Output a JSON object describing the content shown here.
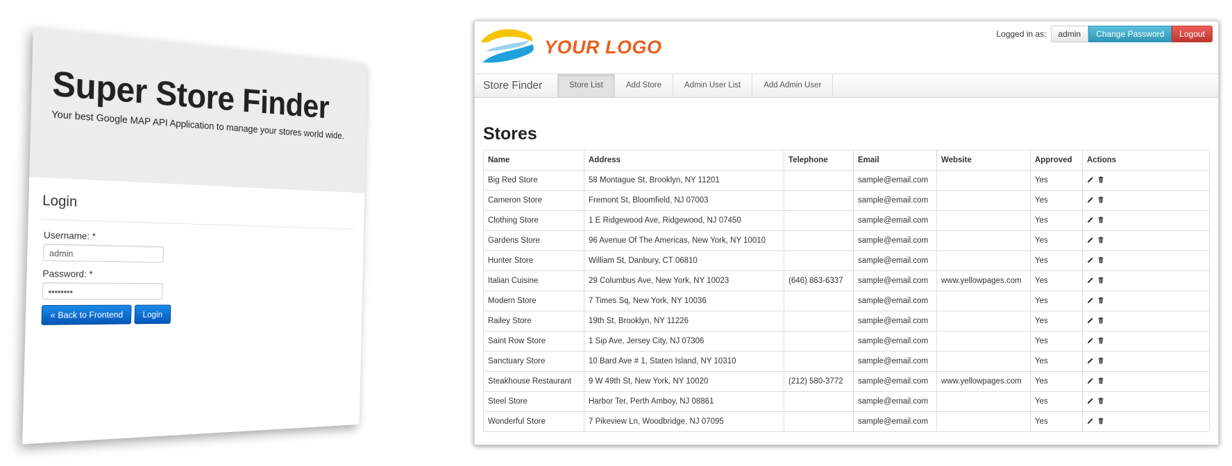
{
  "login_panel": {
    "title": "Super Store Finder",
    "subtitle": "Your best Google MAP API Application to manage your stores world wide.",
    "section_title": "Login",
    "username_label": "Username: *",
    "username_value": "admin",
    "password_label": "Password: *",
    "password_value": "••••••••",
    "back_button": "« Back to Frontend",
    "login_button": "Login"
  },
  "admin": {
    "logo_text": "YOUR LOGO",
    "logged_in_label": "Logged in as:",
    "user_button": "admin",
    "change_password_button": "Change Password",
    "logout_button": "Logout",
    "brand": "Store Finder",
    "nav": [
      "Store List",
      "Add Store",
      "Admin User List",
      "Add Admin User"
    ],
    "active_nav": "Store List",
    "page_title": "Stores",
    "columns": [
      "Name",
      "Address",
      "Telephone",
      "Email",
      "Website",
      "Approved",
      "Actions"
    ],
    "rows": [
      {
        "name": "Big Red Store",
        "address": "58 Montague St, Brooklyn, NY 11201",
        "telephone": "",
        "email": "sample@email.com",
        "website": "",
        "approved": "Yes"
      },
      {
        "name": "Cameron Store",
        "address": "Fremont St, Bloomfield, NJ 07003",
        "telephone": "",
        "email": "sample@email.com",
        "website": "",
        "approved": "Yes"
      },
      {
        "name": "Clothing Store",
        "address": "1 E Ridgewood Ave, Ridgewood, NJ 07450",
        "telephone": "",
        "email": "sample@email.com",
        "website": "",
        "approved": "Yes"
      },
      {
        "name": "Gardens Store",
        "address": "96 Avenue Of The Americas, New York, NY 10010",
        "telephone": "",
        "email": "sample@email.com",
        "website": "",
        "approved": "Yes"
      },
      {
        "name": "Hunter Store",
        "address": "William St, Danbury, CT 06810",
        "telephone": "",
        "email": "sample@email.com",
        "website": "",
        "approved": "Yes"
      },
      {
        "name": "Italian Cuisine",
        "address": "29 Columbus Ave, New York, NY 10023",
        "telephone": "(646) 863-6337",
        "email": "sample@email.com",
        "website": "www.yellowpages.com",
        "approved": "Yes"
      },
      {
        "name": "Modern Store",
        "address": "7 Times Sq, New York, NY 10036",
        "telephone": "",
        "email": "sample@email.com",
        "website": "",
        "approved": "Yes"
      },
      {
        "name": "Railey Store",
        "address": "19th St, Brooklyn, NY 11226",
        "telephone": "",
        "email": "sample@email.com",
        "website": "",
        "approved": "Yes"
      },
      {
        "name": "Saint Row Store",
        "address": "1 Sip Ave, Jersey City, NJ 07306",
        "telephone": "",
        "email": "sample@email.com",
        "website": "",
        "approved": "Yes"
      },
      {
        "name": "Sanctuary Store",
        "address": "10 Bard Ave # 1, Staten Island, NY 10310",
        "telephone": "",
        "email": "sample@email.com",
        "website": "",
        "approved": "Yes"
      },
      {
        "name": "Steakhouse Restaurant",
        "address": "9 W 49th St, New York, NY 10020",
        "telephone": "(212) 580-3772",
        "email": "sample@email.com",
        "website": "www.yellowpages.com",
        "approved": "Yes"
      },
      {
        "name": "Steel Store",
        "address": "Harbor Ter, Perth Amboy, NJ 08861",
        "telephone": "",
        "email": "sample@email.com",
        "website": "",
        "approved": "Yes"
      },
      {
        "name": "Wonderful Store",
        "address": "7 Pikeview Ln, Woodbridge, NJ 07095",
        "telephone": "",
        "email": "sample@email.com",
        "website": "",
        "approved": "Yes"
      }
    ],
    "row_actions": [
      "edit-icon",
      "trash-icon"
    ]
  },
  "colors": {
    "logo_text": "#e8601c",
    "logo_yellow": "#f5c400",
    "logo_blue": "#1fa2dc",
    "change_password": "#2f96b4",
    "logout": "#bd362f",
    "login_button": "#0557b8"
  }
}
